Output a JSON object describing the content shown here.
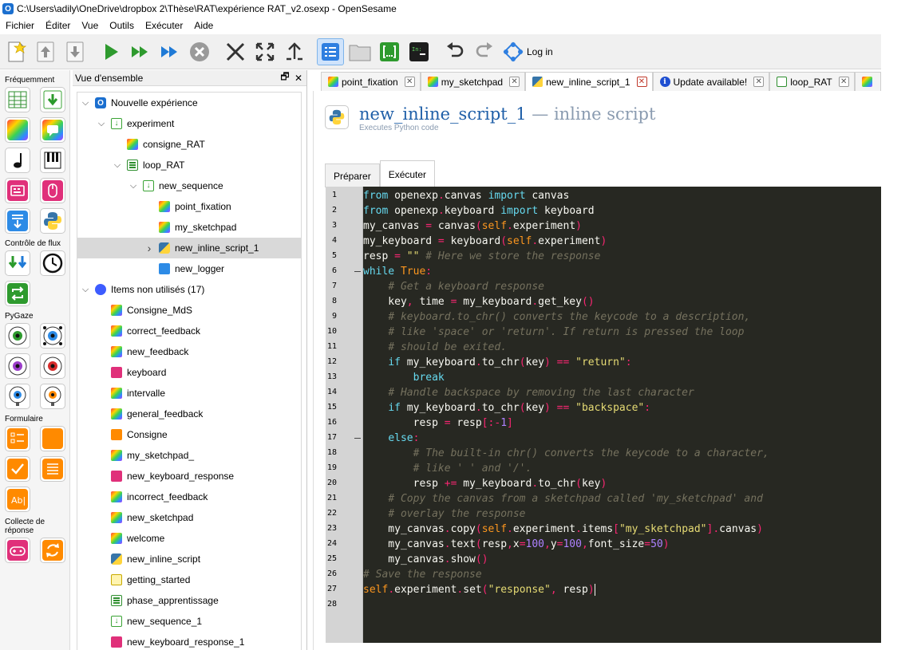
{
  "window": {
    "title": "C:\\Users\\adily\\OneDrive\\dropbox 2\\Thèse\\RAT\\expérience RAT_v2.osexp - OpenSesame",
    "logo": "O"
  },
  "menu": [
    "Fichier",
    "Éditer",
    "Vue",
    "Outils",
    "Exécuter",
    "Aide"
  ],
  "toolbar": {
    "buttons": [
      "new-icon",
      "open-icon",
      "save-icon",
      "run-icon",
      "run-in-window-icon",
      "quick-run-icon",
      "kill-icon",
      "close-all-icon",
      "fullscreen-icon",
      "pin-icon",
      "overview-toggle-icon",
      "file-pool-icon",
      "variable-inspector-icon",
      "debug-window-icon",
      "undo-icon",
      "redo-icon"
    ],
    "login_label": "Log in"
  },
  "itembar": {
    "sections": [
      "Fréquemment",
      "Contrôle de flux",
      "PyGaze",
      "Formulaire",
      "Collecte de réponse"
    ]
  },
  "overview": {
    "title": "Vue d'ensemble",
    "float_glyph": "🗗",
    "close_glyph": "✕",
    "tree": [
      {
        "label": "Nouvelle expérience",
        "arrow": "v"
      },
      {
        "label": "experiment",
        "arrow": "v"
      },
      {
        "label": "consigne_RAT",
        "arrow": ""
      },
      {
        "label": "loop_RAT",
        "arrow": "v"
      },
      {
        "label": "new_sequence",
        "arrow": "v"
      },
      {
        "label": "point_fixation",
        "arrow": ""
      },
      {
        "label": "my_sketchpad",
        "arrow": ""
      },
      {
        "label": "new_inline_script_1",
        "arrow": ">"
      },
      {
        "label": "new_logger",
        "arrow": ""
      },
      {
        "label": "Items non utilisés (17)",
        "arrow": "v"
      },
      {
        "label": "Consigne_MdS",
        "arrow": ""
      },
      {
        "label": "correct_feedback",
        "arrow": ""
      },
      {
        "label": "new_feedback",
        "arrow": ""
      },
      {
        "label": "keyboard",
        "arrow": ""
      },
      {
        "label": "intervalle",
        "arrow": ""
      },
      {
        "label": "general_feedback",
        "arrow": ""
      },
      {
        "label": "Consigne",
        "arrow": ""
      },
      {
        "label": "my_sketchpad_",
        "arrow": ""
      },
      {
        "label": "new_keyboard_response",
        "arrow": ""
      },
      {
        "label": "incorrect_feedback",
        "arrow": ""
      },
      {
        "label": "new_sketchpad",
        "arrow": ""
      },
      {
        "label": "welcome",
        "arrow": ""
      },
      {
        "label": "new_inline_script",
        "arrow": ""
      },
      {
        "label": "getting_started",
        "arrow": ""
      },
      {
        "label": "phase_apprentissage",
        "arrow": ""
      },
      {
        "label": "new_sequence_1",
        "arrow": ""
      },
      {
        "label": "new_keyboard_response_1",
        "arrow": ""
      }
    ]
  },
  "tabs": [
    {
      "label": "point_fixation"
    },
    {
      "label": "my_sketchpad"
    },
    {
      "label": "new_inline_script_1"
    },
    {
      "label": "Update available!"
    },
    {
      "label": "loop_RAT"
    }
  ],
  "tab_close_glyph": "✕",
  "item": {
    "name": "new_inline_script_1",
    "type_suffix": " — inline script",
    "description": "Executes Python code"
  },
  "subtabs": [
    "Préparer",
    "Exécuter"
  ],
  "editor": {
    "line_numbers": [
      "1",
      "2",
      "3",
      "4",
      "5",
      "6",
      "7",
      "8",
      "9",
      "10",
      "11",
      "12",
      "13",
      "14",
      "15",
      "16",
      "17",
      "18",
      "19",
      "20",
      "21",
      "22",
      "23",
      "24",
      "25",
      "26",
      "27",
      "28"
    ],
    "lines": [
      "from openexp.canvas import canvas",
      "from openexp.keyboard import keyboard",
      "my_canvas = canvas(self.experiment)",
      "my_keyboard = keyboard(self.experiment)",
      "resp = \"\" # Here we store the response",
      "while True:",
      "    # Get a keyboard response",
      "    key, time = my_keyboard.get_key()",
      "    # keyboard.to_chr() converts the keycode to a description,",
      "    # like 'space' or 'return'. If return is pressed the loop",
      "    # should be exited.",
      "    if my_keyboard.to_chr(key) == \"return\":",
      "        break",
      "    # Handle backspace by removing the last character",
      "    if my_keyboard.to_chr(key) == \"backspace\":",
      "        resp = resp[:-1]",
      "    else:",
      "        # The built-in chr() converts the keycode to a character,",
      "        # like ' ' and '/'.",
      "        resp += my_keyboard.to_chr(key)",
      "    # Copy the canvas from a sketchpad called 'my_sketchpad' and",
      "    # overlay the response",
      "    my_canvas.copy(self.experiment.items[\"my_sketchpad\"].canvas)",
      "    my_canvas.text(resp,x=100,y=100,font_size=50)",
      "    my_canvas.show()",
      "# Save the response",
      "self.experiment.set(\"response\", resp)",
      ""
    ]
  }
}
